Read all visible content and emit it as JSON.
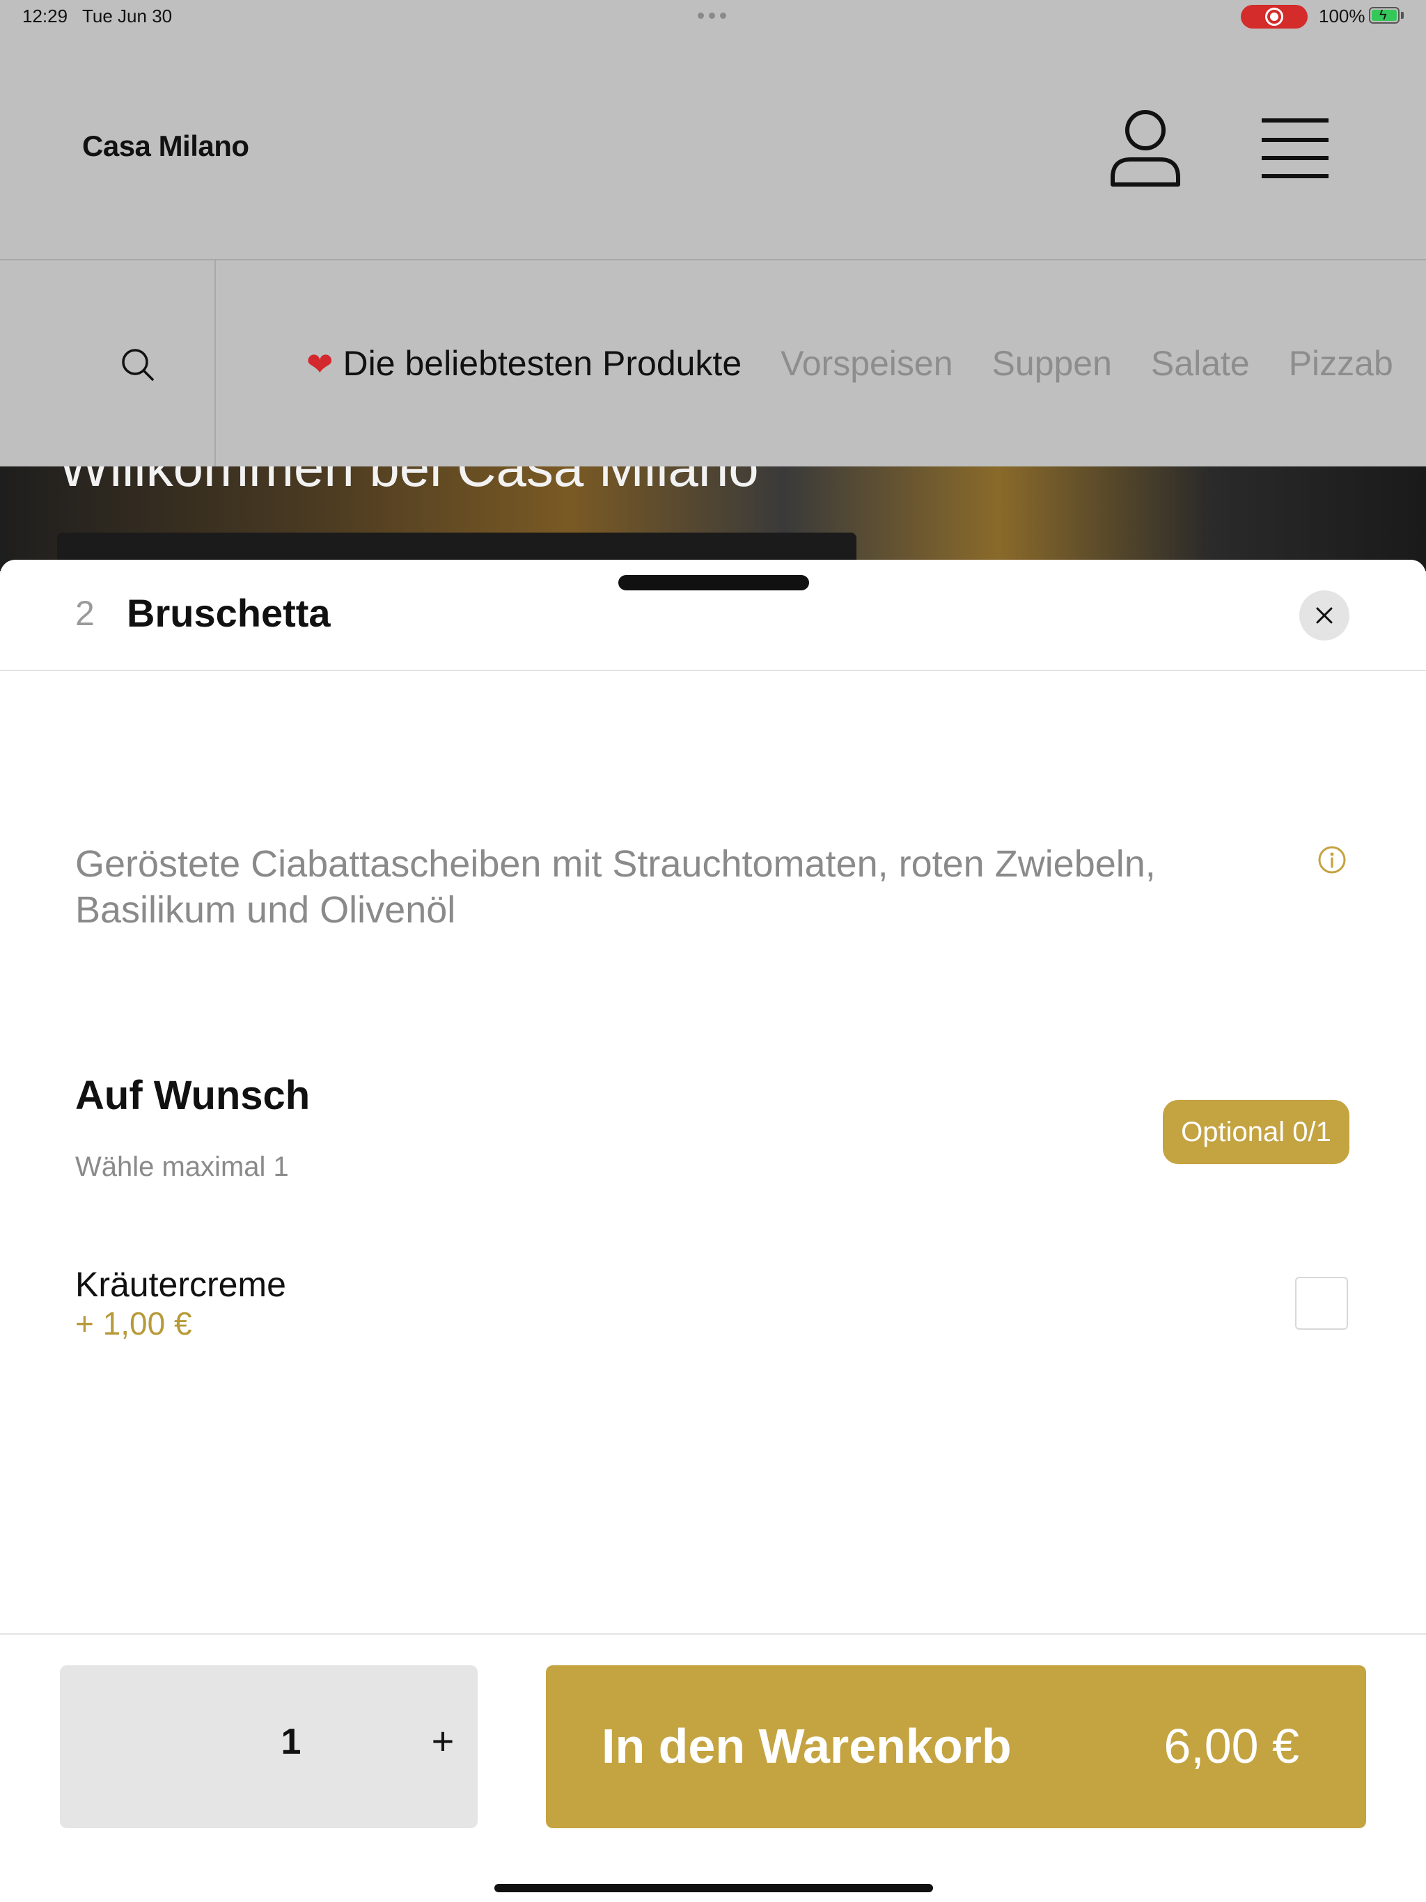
{
  "status_bar": {
    "time": "12:29",
    "date": "Tue Jun 30",
    "battery": "100%"
  },
  "header": {
    "brand": "Casa Milano"
  },
  "categories": [
    {
      "label": "Die beliebtesten Produkte",
      "active": true
    },
    {
      "label": "Vorspeisen",
      "active": false
    },
    {
      "label": "Suppen",
      "active": false
    },
    {
      "label": "Salate",
      "active": false
    },
    {
      "label": "Pizzab",
      "active": false
    }
  ],
  "hero": {
    "title": "Willkommen bei Casa Milano"
  },
  "sheet": {
    "item_number": "2",
    "item_title": "Bruschetta",
    "description": "Geröstete Ciabattascheiben mit Strauchtomaten, roten Zwiebeln, Basilikum und Olivenöl",
    "group": {
      "title": "Auf Wunsch",
      "subtitle": "Wähle maximal 1",
      "badge": "Optional 0/1",
      "options": [
        {
          "name": "Kräutercreme",
          "price": "+ 1,00 €",
          "checked": false
        }
      ]
    },
    "footer": {
      "quantity": "1",
      "plus": "+",
      "cart_label": "In den Warenkorb",
      "cart_price": "6,00 €"
    }
  },
  "colors": {
    "accent": "#c4a341",
    "overlay": "#bfbfbf",
    "heart": "#d2282e"
  },
  "icons": [
    "user-icon",
    "hamburger-menu-icon",
    "search-icon",
    "heart-icon",
    "close-icon",
    "info-icon"
  ]
}
